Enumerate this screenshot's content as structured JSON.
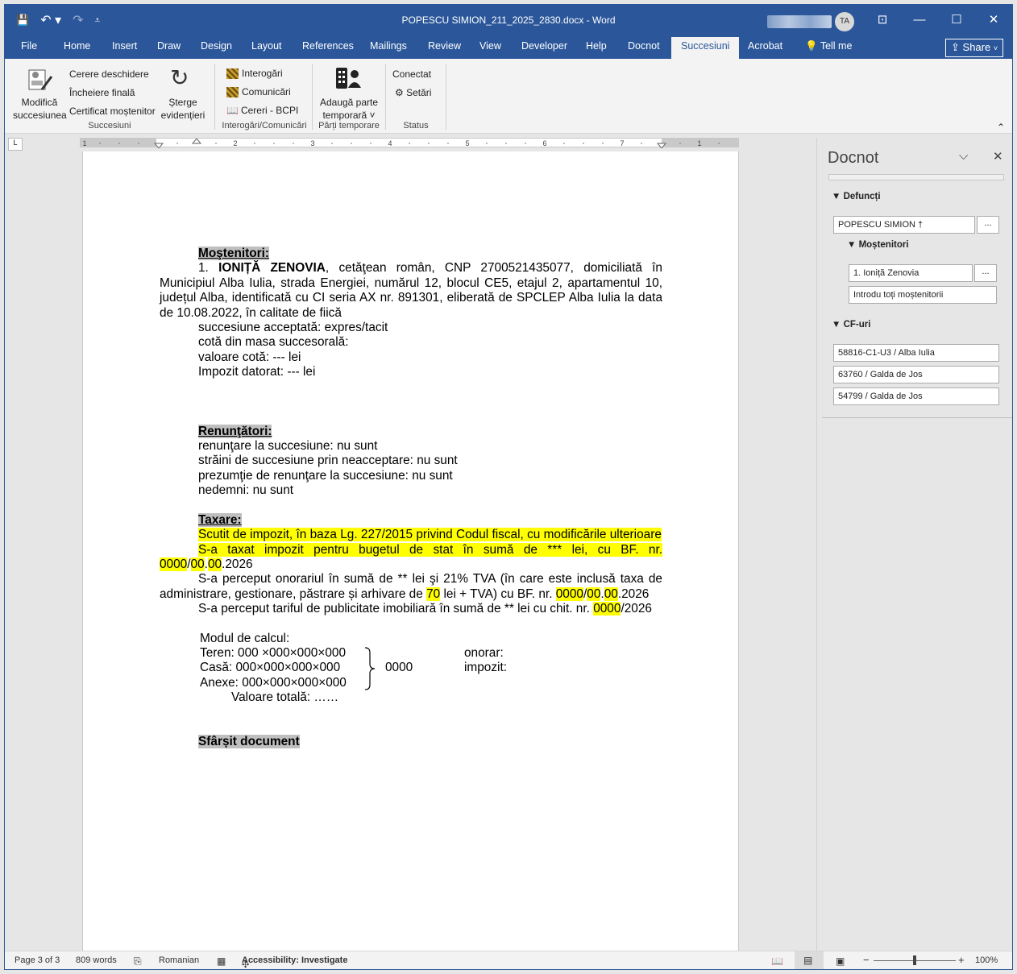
{
  "window": {
    "title": "POPESCU SIMION_211_2025_2830.docx - Word",
    "user_initials": "TA",
    "controls": {
      "ribbon_display": "⊡",
      "minimize": "—",
      "maximize": "☐",
      "close": "✕"
    }
  },
  "qat": {
    "save": "💾",
    "undo": "↶ ▾",
    "redo": "↷",
    "customize": "⩡"
  },
  "tabs": [
    {
      "label": "File"
    },
    {
      "label": "Home"
    },
    {
      "label": "Insert"
    },
    {
      "label": "Draw"
    },
    {
      "label": "Design"
    },
    {
      "label": "Layout"
    },
    {
      "label": "References"
    },
    {
      "label": "Mailings"
    },
    {
      "label": "Review"
    },
    {
      "label": "View"
    },
    {
      "label": "Developer"
    },
    {
      "label": "Help"
    },
    {
      "label": "Docnot"
    },
    {
      "label": "Succesiuni"
    },
    {
      "label": "Acrobat"
    }
  ],
  "tellme": "Tell me",
  "share": "Share",
  "ribbon": {
    "succesiuni": {
      "modifica_line1": "Modifică",
      "modifica_line2": "succesiunea",
      "cerere_deschidere": "Cerere deschidere",
      "incheiere_finala": "Încheiere finală",
      "certificat_mostenitor": "Certificat moștenitor",
      "sterge_line1": "Șterge",
      "sterge_line2": "evidențieri",
      "group_label": "Succesiuni"
    },
    "interogari": {
      "interogari": "Interogări",
      "comunicari": "Comunicări",
      "cereri_bcpi": "Cereri - BCPI",
      "group_label": "Interogări/Comunicări"
    },
    "parti": {
      "adauga_line1": "Adaugă parte",
      "adauga_line2": "temporară ˅",
      "group_label": "Părți temporare"
    },
    "status": {
      "conectat": "Conectat",
      "setari": "Setări",
      "group_label": "Status"
    },
    "collapse": "⌃"
  },
  "ruler": {
    "corner": "L",
    "numbers": [
      "1",
      "1",
      "2",
      "3",
      "4",
      "5",
      "6",
      "7"
    ]
  },
  "document": {
    "h_mostenitori": "Moştenitori:",
    "heir_num": "1. ",
    "heir_name": "IONIȚĂ ZENOVIA",
    "heir_details": ", cetăţean român, CNP 2700521435077, domiciliată în Municipiul Alba Iulia, strada Energiei, numărul 12, blocul CE5, etajul 2, apartamentul 10, județul Alba, identificată cu CI seria AX nr. 891301, eliberată de SPCLEP Alba Iulia la data de 10.08.2022, în calitate de fiică",
    "succesiune_acceptata": "succesiune acceptată: expres/tacit",
    "cota_masa": "cotă din masa succesorală:",
    "valoare_cota": "valoare cotă: --- lei",
    "impozit_datorat": "Impozit datorat: --- lei",
    "h_renuntatori": "Renunţători:",
    "renuntare": "renunţare la succesiune: nu sunt",
    "straini": "străini de succesiune prin neacceptare: nu sunt",
    "prezumtie": "prezumţie de renunţare la succesiune: nu sunt",
    "nedemni": "nedemni: nu sunt",
    "h_taxare": "Taxare:",
    "scutit": "Scutit de impozit, în baza Lg. 227/2015 privind Codul fiscal, cu modificările ulterioare",
    "taxat_a": "S-a taxat impozit pentru bugetul de stat în sumă de *** lei, cu BF. nr. 0000",
    "taxat_b": "/",
    "taxat_c": "00",
    "taxat_d": ".",
    "taxat_e": "00",
    "taxat_f": ".2026",
    "onorariu_a": "S-a perceput onorariul în sumă de ** lei şi 21% TVA (în care este inclusă taxa de administrare, gestionare, păstrare și arhivare de ",
    "onorariu_b": "70",
    "onorariu_c": " lei + TVA) cu BF. nr. ",
    "onorariu_d": "0000",
    "onorariu_e": "/",
    "onorariu_f": "00",
    "onorariu_g": ".",
    "onorariu_h": "00",
    "onorariu_i": ".2026",
    "tarif_a": "S-a perceput tariful de publicitate imobiliară în sumă de ** lei cu chit. nr. ",
    "tarif_b": "0000",
    "tarif_c": "/2026",
    "modul_calcul": "Modul de calcul:",
    "teren": "Teren: 000 ×000×000×000",
    "casa": "Casă: 000×000×000×000",
    "anexe": "Anexe: 000×000×000×000",
    "suma": "0000",
    "onorar": "onorar:",
    "impozit": "impozit:",
    "valoare_totala": "Valoare totală: ……",
    "sfarsit": "Sfârșit document"
  },
  "pane": {
    "title": "Docnot",
    "defuncti": "Defuncți",
    "defunct_name": "POPESCU SIMION †",
    "mostenitori": "Moștenitori",
    "heir_entry": "1. Ioniță Zenovia",
    "introdu_toti": "Introdu toți moștenitorii",
    "cf_uri": "CF-uri",
    "cf_list": [
      "58816-C1-U3 / Alba Iulia",
      "63760 / Galda de Jos",
      "54799 / Galda de Jos"
    ],
    "more": "..."
  },
  "statusbar": {
    "page": "Page 3 of 3",
    "words": "809 words",
    "language": "Romanian",
    "accessibility": "Accessibility: Investigate",
    "zoom": "100%",
    "zoom_fraction": 0.5
  }
}
